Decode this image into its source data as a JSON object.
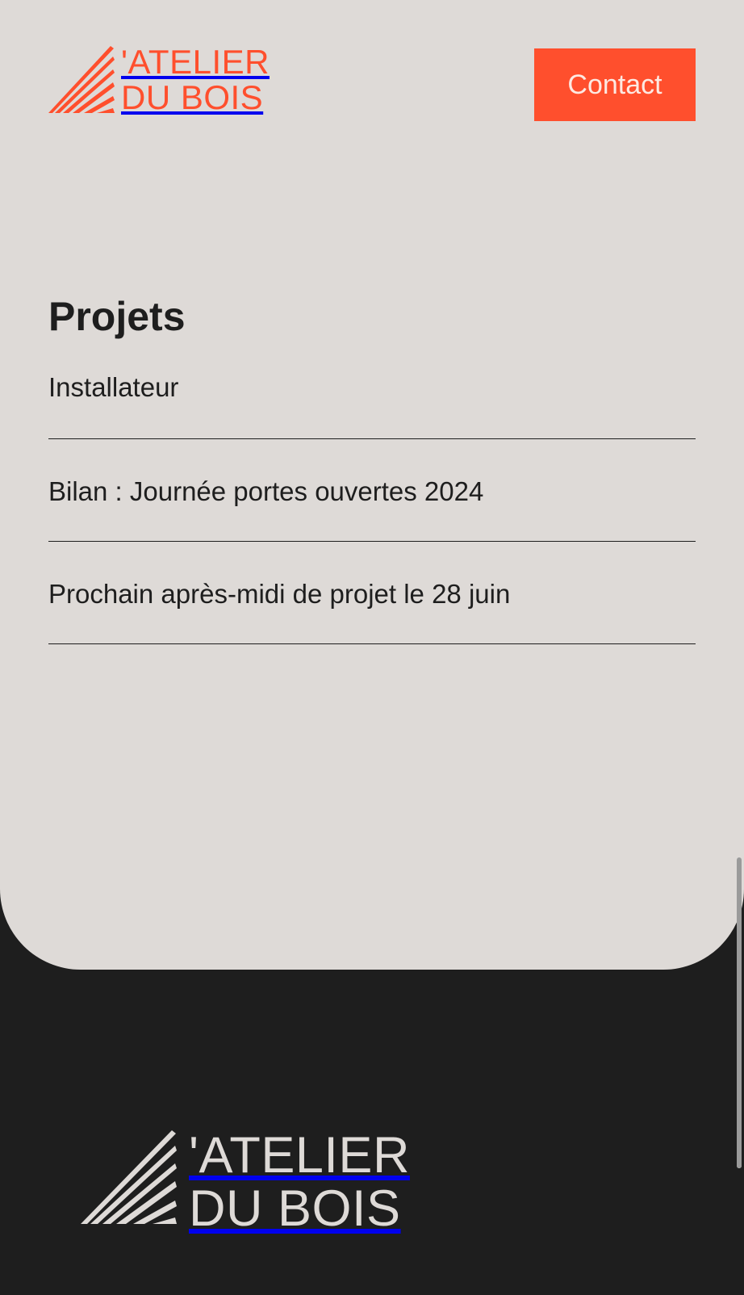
{
  "header": {
    "logo": {
      "line1": "'ATELIER",
      "line2": "DU BOIS",
      "color": "#ff4f2d",
      "icon": "fan-lines-icon"
    },
    "contact_label": "Contact",
    "contact_color": "#ff4f2d"
  },
  "projects": {
    "title": "Projets",
    "items": [
      {
        "label": "Installateur"
      },
      {
        "label": "Bilan : Journée portes ouvertes 2024"
      },
      {
        "label": "Prochain après-midi de projet le 28 juin"
      }
    ]
  },
  "footer": {
    "logo": {
      "line1": "'ATELIER",
      "line2": "DU BOIS",
      "color": "#dedad7",
      "icon": "fan-lines-icon"
    },
    "background": "#1e1e1e"
  },
  "colors": {
    "panel_background": "#dedad7",
    "accent": "#ff4f2d",
    "text": "#1e1e1e"
  }
}
